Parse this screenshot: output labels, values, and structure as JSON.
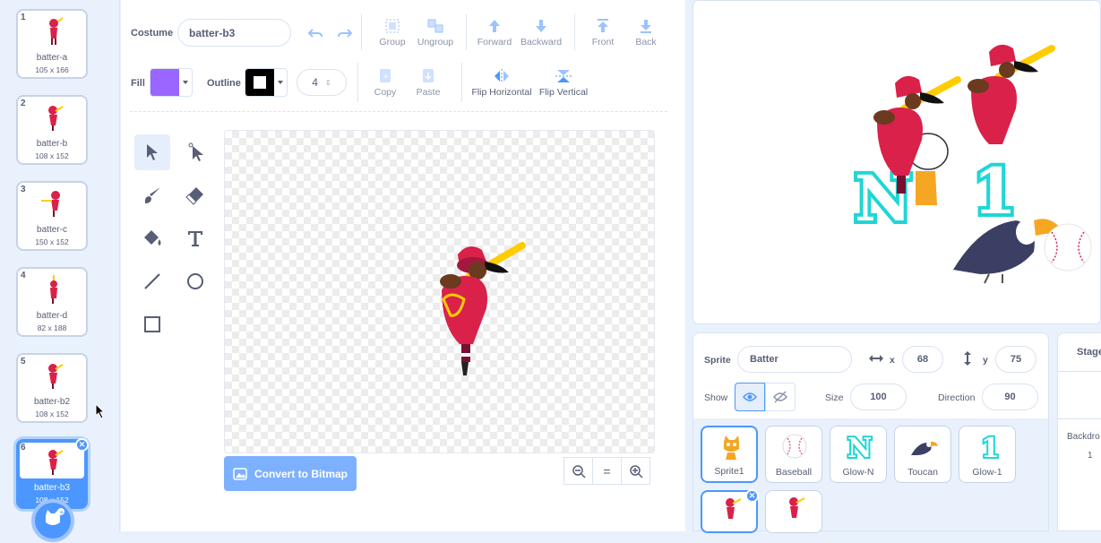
{
  "costumes": [
    {
      "num": "1",
      "name": "batter-a",
      "size": "105 x 166"
    },
    {
      "num": "2",
      "name": "batter-b",
      "size": "108 x 152"
    },
    {
      "num": "3",
      "name": "batter-c",
      "size": "150 x 152"
    },
    {
      "num": "4",
      "name": "batter-d",
      "size": "82 x 188"
    },
    {
      "num": "5",
      "name": "batter-b2",
      "size": "108 x 152"
    },
    {
      "num": "6",
      "name": "batter-b3",
      "size": "108 x 152"
    }
  ],
  "editor": {
    "costume_label": "Costume",
    "costume_name": "batter-b3",
    "fill_label": "Fill",
    "outline_label": "Outline",
    "outline_width": "4",
    "fill_color": "#9966ff",
    "outline_color": "#000000",
    "group": "Group",
    "ungroup": "Ungroup",
    "forward": "Forward",
    "backward": "Backward",
    "front": "Front",
    "back": "Back",
    "copy": "Copy",
    "paste": "Paste",
    "flip_h": "Flip Horizontal",
    "flip_v": "Flip Vertical",
    "convert": "Convert to Bitmap",
    "zoom_reset": "="
  },
  "sprite_info": {
    "sprite_label": "Sprite",
    "sprite_name": "Batter",
    "x_label": "x",
    "x_value": "68",
    "y_label": "y",
    "y_value": "75",
    "show_label": "Show",
    "size_label": "Size",
    "size_value": "100",
    "direction_label": "Direction",
    "direction_value": "90"
  },
  "sprites": [
    {
      "name": "Sprite1"
    },
    {
      "name": "Baseball"
    },
    {
      "name": "Glow-N"
    },
    {
      "name": "Toucan"
    },
    {
      "name": "Glow-1"
    }
  ],
  "stage_panel": {
    "title": "Stage",
    "backdrops_label": "Backdro",
    "backdrops_count": "1"
  },
  "stage_letters": {
    "n": "N",
    "one": "1"
  },
  "colors": {
    "accent": "#4c97ff",
    "text": "#575e75",
    "batter_red": "#d9214a",
    "bat_yellow": "#ffcc00",
    "glow": "#1fd6d6"
  }
}
